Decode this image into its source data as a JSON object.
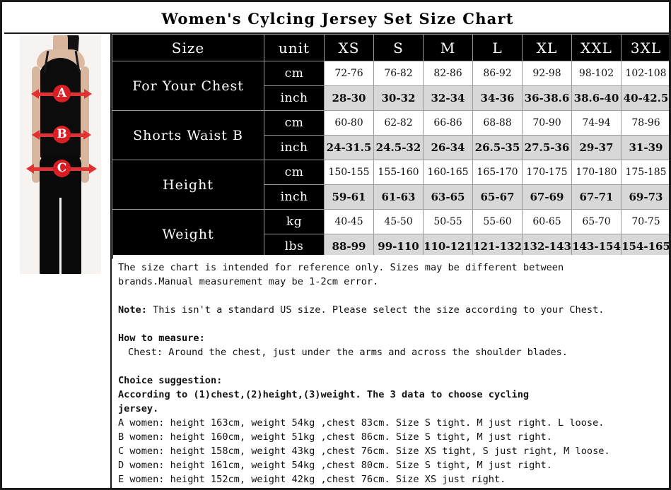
{
  "title": "Women's Cylcing Jersey Set Size Chart",
  "photo": {
    "alt": "woman-in-black-camisole-and-leggings-measurement-guide",
    "markers": [
      {
        "letter": "A",
        "meaning": "chest"
      },
      {
        "letter": "B",
        "meaning": "waist"
      },
      {
        "letter": "C",
        "meaning": "hip"
      }
    ],
    "arrow_color": "#e03232",
    "bubble_color": "#d81f26"
  },
  "table": {
    "corner_label": "Size",
    "unit_header": "unit",
    "sizes": [
      "XS",
      "S",
      "M",
      "L",
      "XL",
      "XXL",
      "3XL"
    ],
    "rows": [
      {
        "label": "For Your Chest",
        "units": [
          {
            "unit": "cm",
            "style": "cm",
            "values": [
              "72-76",
              "76-82",
              "82-86",
              "86-92",
              "92-98",
              "98-102",
              "102-108"
            ]
          },
          {
            "unit": "inch",
            "style": "inch",
            "values": [
              "28-30",
              "30-32",
              "32-34",
              "34-36",
              "36-38.6",
              "38.6-40",
              "40-42.5"
            ]
          }
        ]
      },
      {
        "label": "Shorts Waist B",
        "units": [
          {
            "unit": "cm",
            "style": "cm",
            "values": [
              "60-80",
              "62-82",
              "66-86",
              "68-88",
              "70-90",
              "74-94",
              "78-96"
            ]
          },
          {
            "unit": "inch",
            "style": "inch",
            "values": [
              "24-31.5",
              "24.5-32",
              "26-34",
              "26.5-35",
              "27.5-36",
              "29-37",
              "31-39"
            ]
          }
        ]
      },
      {
        "label": "Height",
        "units": [
          {
            "unit": "cm",
            "style": "cm",
            "values": [
              "150-155",
              "155-160",
              "160-165",
              "165-170",
              "170-175",
              "170-180",
              "175-185"
            ]
          },
          {
            "unit": "inch",
            "style": "inch",
            "values": [
              "59-61",
              "61-63",
              "63-65",
              "65-67",
              "67-69",
              "67-71",
              "69-73"
            ]
          }
        ]
      },
      {
        "label": "Weight",
        "units": [
          {
            "unit": "kg",
            "style": "cm",
            "values": [
              "40-45",
              "45-50",
              "50-55",
              "55-60",
              "60-65",
              "65-70",
              "70-75"
            ]
          },
          {
            "unit": "lbs",
            "style": "inch",
            "values": [
              "88-99",
              "99-110",
              "110-121",
              "121-132",
              "132-143",
              "143-154",
              "154-165"
            ]
          }
        ]
      }
    ],
    "colors": {
      "header_bg": "#000000",
      "cm_row_bg": "#ffffff",
      "inch_row_bg": "#d8d8d8",
      "grid": "#9a9a9a"
    }
  },
  "notes": {
    "disclaimer_line1": "The size chart is intended for reference only. Sizes may be different between",
    "disclaimer_line2": "brands.Manual measurement may be 1-2cm error.",
    "note_label": "Note:",
    "note_text": " This isn't a standard US size. Please select the size according to your Chest.",
    "how_to_measure_heading": "How to measure:",
    "how_to_measure_item": "Chest: Around the chest, just under the arms and across the shoulder blades.",
    "choice_heading": "Choice suggestion:",
    "choice_line1": "According to (1)chest,(2)height,(3)weight. The 3 data to choose cycling",
    "choice_line2": "jersey.",
    "examples": [
      "A women: height 163cm, weight 54kg ,chest 83cm. Size S tight. M just right. L loose.",
      "B women: height 160cm, weight 51kg ,chest 86cm. Size S tight, M just right.",
      "C women: height 158cm, weight 43kg ,chest 76cm. Size XS tight, S just right, M loose.",
      "D women: height 161cm, weight 54kg ,chest 80cm. Size S tight, M just right.",
      "E women: height 152cm, weight 42kg ,chest 76cm. Size XS just right."
    ]
  }
}
